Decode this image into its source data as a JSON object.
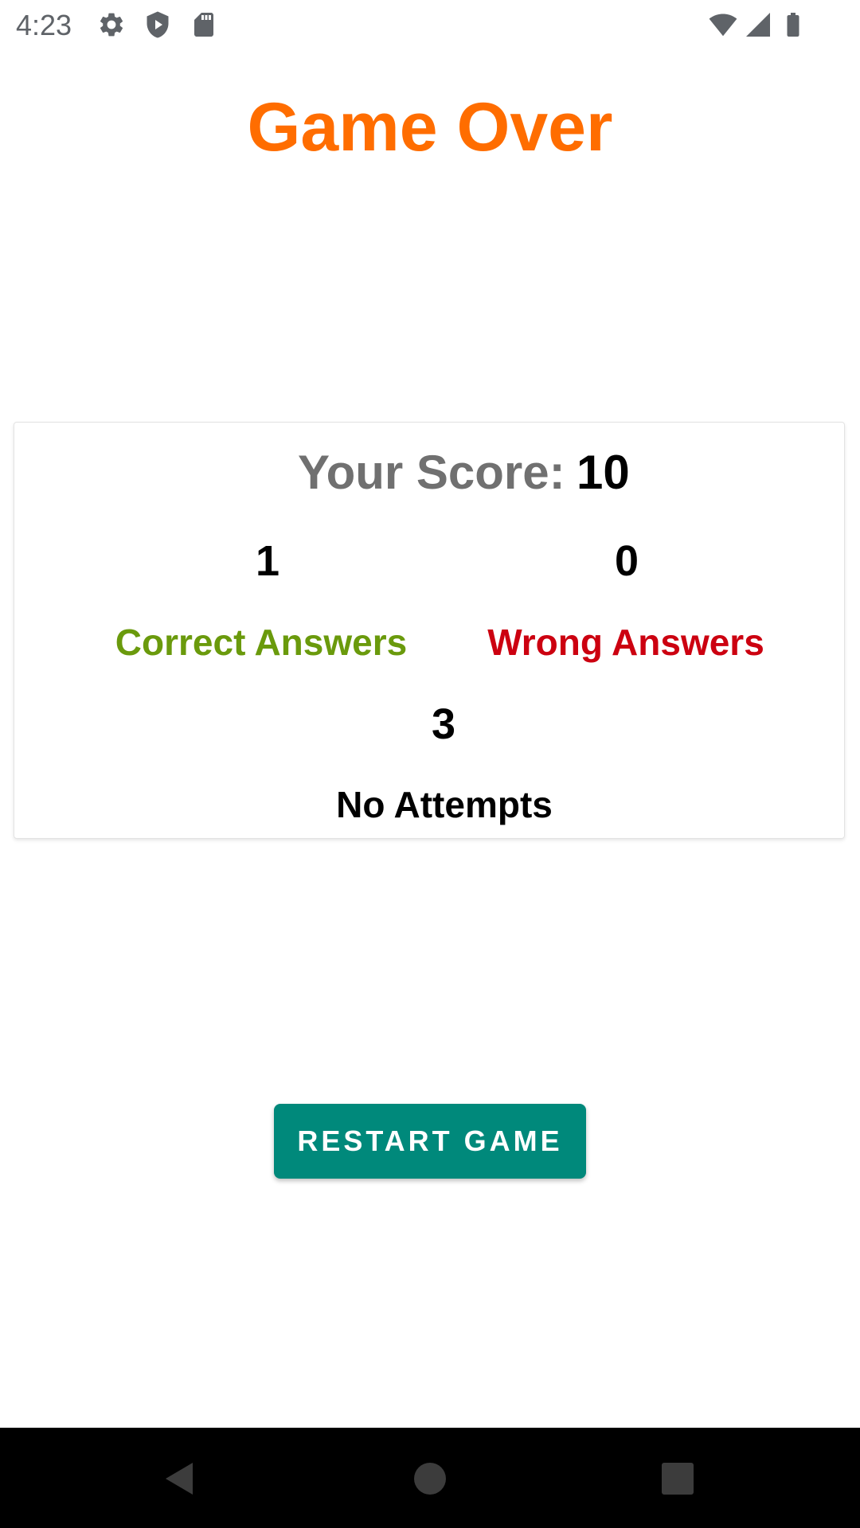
{
  "status_bar": {
    "time": "4:23",
    "left_icons": [
      "gear-icon",
      "shield-play-icon",
      "sd-card-icon"
    ],
    "right_icons": [
      "wifi-icon",
      "signal-icon",
      "battery-icon"
    ]
  },
  "title": "Game Over",
  "score": {
    "label": "Your Score:",
    "value": "10"
  },
  "stats": {
    "correct": {
      "value": "1",
      "label": "Correct Answers"
    },
    "wrong": {
      "value": "0",
      "label": "Wrong Answers"
    },
    "no_attempts": {
      "value": "3",
      "label": "No Attempts"
    }
  },
  "restart_button": {
    "label": "RESTART GAME"
  },
  "nav_bar": {
    "buttons": [
      "back-icon",
      "home-icon",
      "recents-icon"
    ]
  },
  "colors": {
    "title": "#ff6d00",
    "score_label": "#707070",
    "correct": "#6a9a0c",
    "wrong": "#cc0010",
    "button": "#00897b"
  }
}
